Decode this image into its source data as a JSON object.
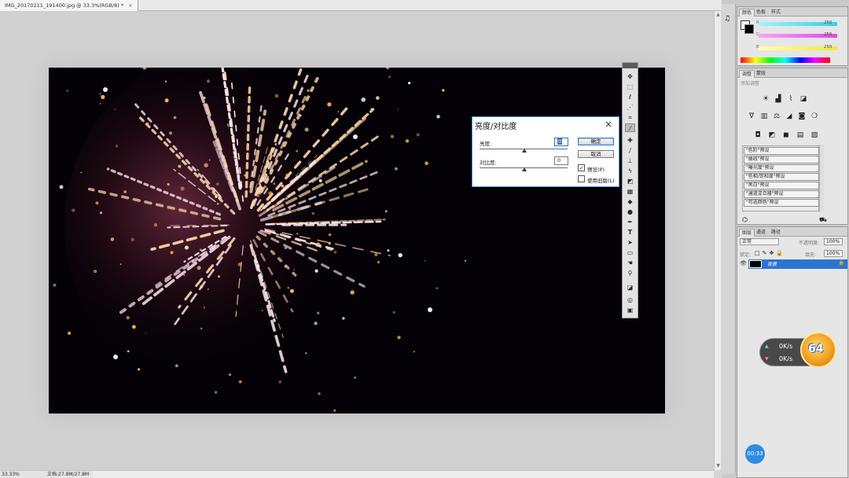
{
  "document": {
    "tab_title": "IMG_20170211_191400.jpg @ 33.3%(RGB/8) *",
    "close_symbol": "×"
  },
  "status": {
    "zoom": "33.33%",
    "doc_size": "文档:27.8M/27.8M"
  },
  "dialog": {
    "title": "亮度/对比度",
    "close_symbol": "×",
    "brightness_label": "亮度:",
    "brightness_value": "0",
    "contrast_label": "对比度:",
    "contrast_value": "0",
    "ok_label": "确定",
    "cancel_label": "取消",
    "preview_label": "预览(P)",
    "preview_checked": true,
    "legacy_label": "使用旧版(L)",
    "legacy_checked": false
  },
  "color_panel": {
    "tabs": [
      "颜色",
      "色板",
      "样式"
    ],
    "active_tab": "颜色",
    "channels": [
      {
        "label": "R",
        "value": "255",
        "color": "#35d0e8"
      },
      {
        "label": "G",
        "value": "255",
        "color": "#e04ae0"
      },
      {
        "label": "B",
        "value": "255",
        "color": "#ecec3c"
      }
    ]
  },
  "adjustments_panel": {
    "tabs": [
      "调整",
      "蒙版"
    ],
    "active_tab": "调整",
    "subtitle": "添加调整",
    "presets": [
      "\"色阶\"预设",
      "\"曲线\"预设",
      "\"曝光度\"预设",
      "\"色相/饱和度\"预设",
      "\"黑白\"预设",
      "\"通道混合器\"预设",
      "\"可选颜色\"预设"
    ]
  },
  "layers_panel": {
    "tabs": [
      "图层",
      "通道",
      "路径"
    ],
    "active_tab": "图层",
    "blend_mode": "正常",
    "opacity_label": "不透明度:",
    "opacity_value": "100%",
    "lock_label": "锁定:",
    "fill_label": "填充:",
    "fill_value": "100%",
    "layers": [
      {
        "name": "背景",
        "visible": true,
        "locked": true
      }
    ]
  },
  "speed_widget": {
    "upload": "0K/s",
    "download": "0K/s",
    "badge": "64"
  },
  "timer": "00:33",
  "tools": [
    "move",
    "marquee",
    "lasso",
    "quick-select",
    "crop",
    "eyedropper",
    "healing",
    "brush",
    "stamp",
    "history-brush",
    "eraser",
    "gradient",
    "blur",
    "dodge",
    "pen",
    "type",
    "path-select",
    "shape",
    "hand",
    "zoom",
    "colors",
    "quick-mask",
    "screen-mode"
  ]
}
